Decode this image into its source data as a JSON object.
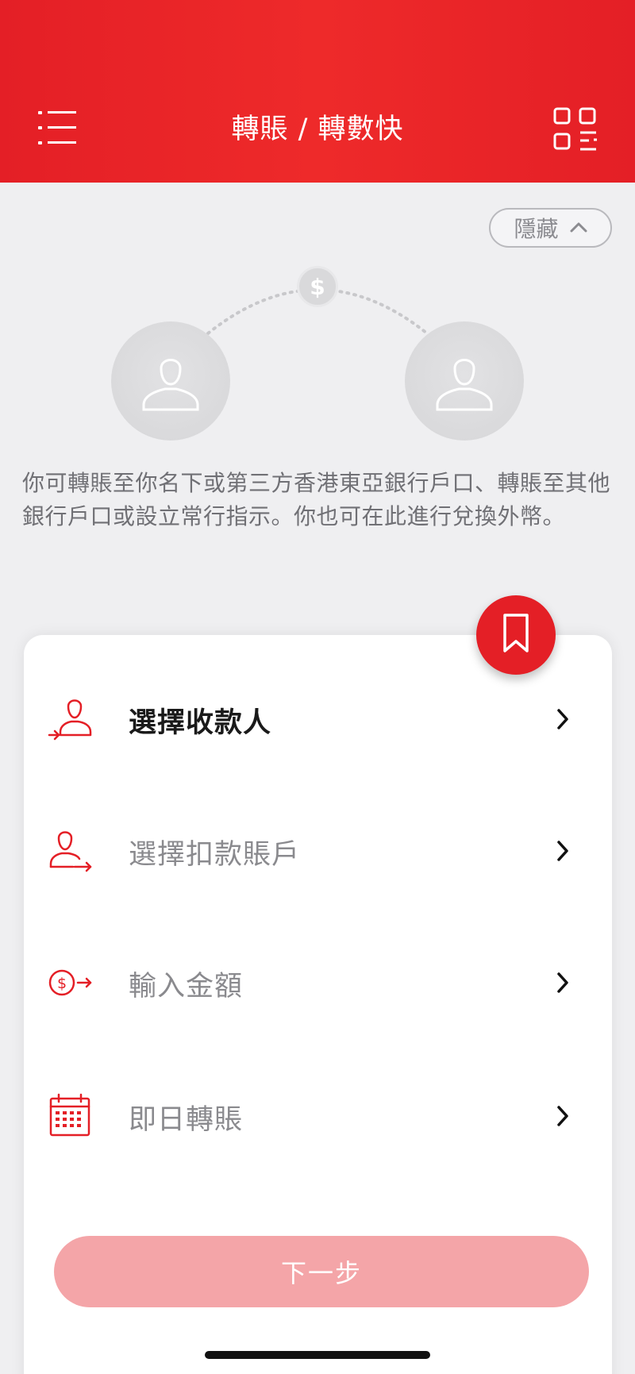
{
  "header": {
    "title": "轉賬 / 轉數快",
    "menu_icon": "hamburger-menu-icon",
    "qr_icon": "qr-code-icon",
    "background_color": "#e41f26"
  },
  "toggle": {
    "label": "隱藏",
    "icon": "chevron-up-icon"
  },
  "illustration": {
    "left_avatar_icon": "person-icon",
    "right_avatar_icon": "person-icon",
    "center_icon": "dollar-coin-icon",
    "center_symbol": "$"
  },
  "intro_text": "你可轉賬至你名下或第三方香港東亞銀行戶口、轉賬至其他銀行戶口或設立常行指示。你也可在此進行兌換外幣。",
  "bookmark_icon": "bookmark-icon",
  "steps": [
    {
      "label": "選擇收款人",
      "icon": "person-arrow-in-icon",
      "active": true
    },
    {
      "label": "選擇扣款賬戶",
      "icon": "person-arrow-out-icon",
      "active": false
    },
    {
      "label": "輸入金額",
      "icon": "dollar-arrow-icon",
      "active": false
    },
    {
      "label": "即日轉賬",
      "icon": "calendar-icon",
      "active": false
    }
  ],
  "next_button": {
    "label": "下一步",
    "color": "#f4a5a8"
  },
  "accent_color": "#e41f26"
}
